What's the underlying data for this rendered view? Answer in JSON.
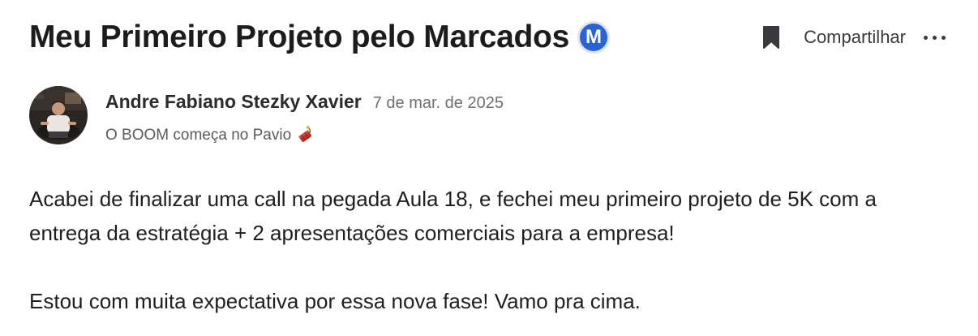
{
  "post": {
    "title": "Meu Primeiro Projeto pelo Marcados",
    "badge_letter": "M",
    "badge_color": "#2a63d8",
    "actions": {
      "bookmark_icon": "bookmark-icon",
      "share_label": "Compartilhar",
      "more_icon": "more-horizontal-icon"
    },
    "author": {
      "name": "Andre Fabiano Stezky Xavier",
      "date": "7 de mar. de 2025",
      "tagline": "O BOOM começa no Pavio",
      "tagline_icon": "dynamite-icon"
    },
    "body": {
      "paragraph_1": "Acabei de finalizar uma call na pegada Aula 18, e fechei meu primeiro projeto de 5K com a entrega da estratégia + 2 apresentações comerciais para a empresa!",
      "paragraph_2": "Estou com muita expectativa por essa nova fase! Vamo pra cima."
    }
  }
}
